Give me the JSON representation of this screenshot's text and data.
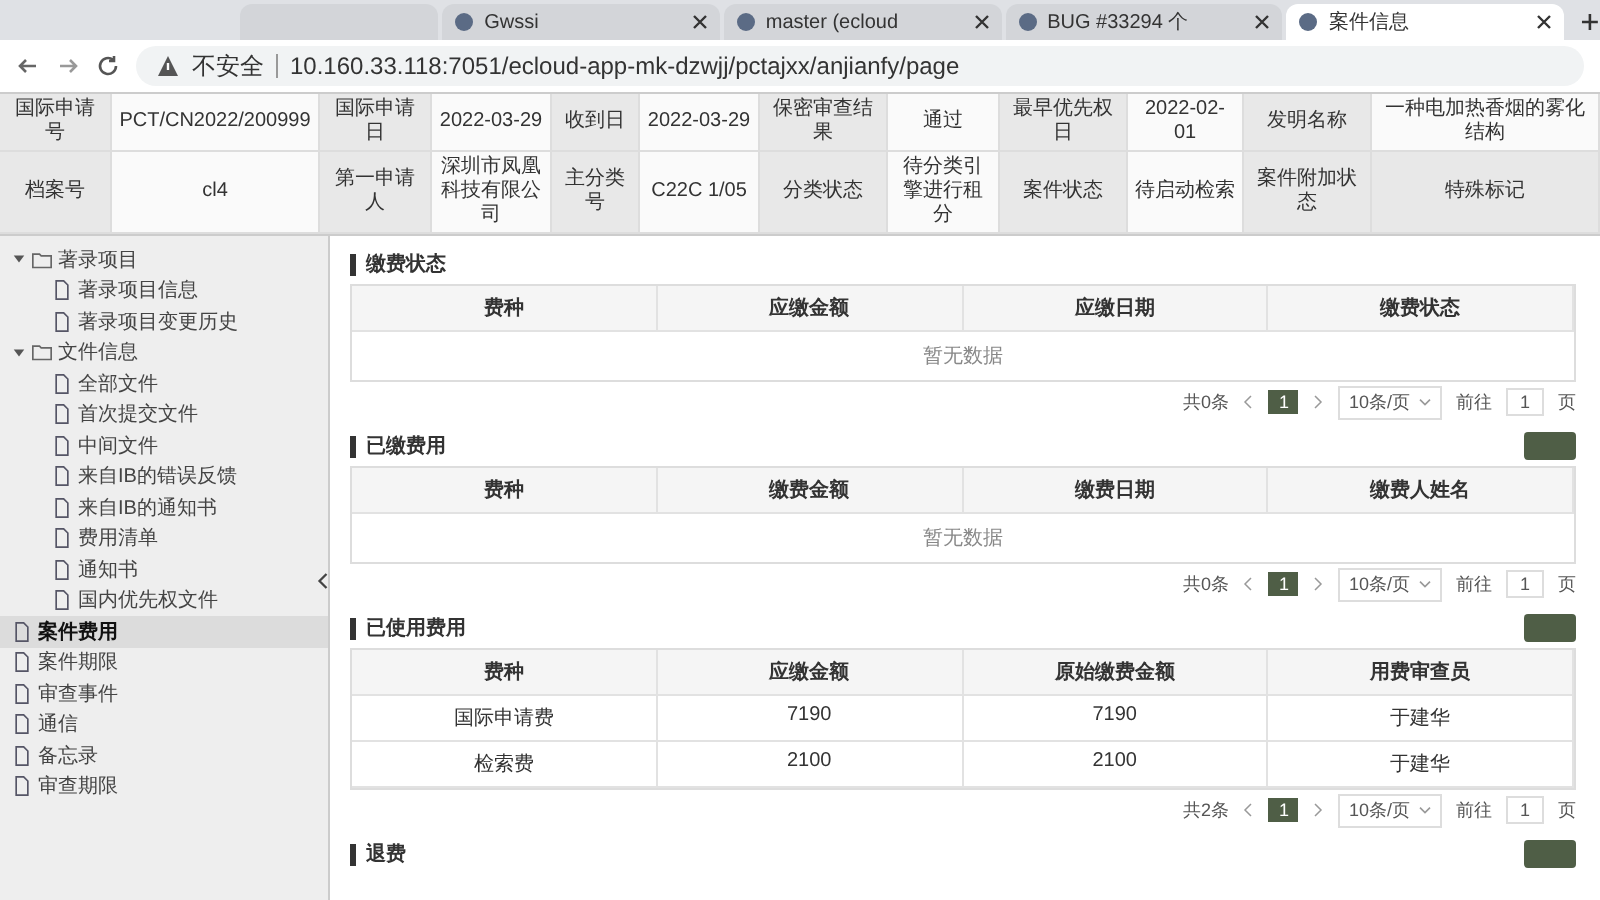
{
  "browser": {
    "tabs": [
      {
        "title": "Gwssi",
        "selected": false
      },
      {
        "title": "master (ecloud",
        "selected": false
      },
      {
        "title": "BUG #33294 个",
        "selected": false
      },
      {
        "title": "案件信息",
        "selected": true
      }
    ],
    "address": {
      "security": "不安全",
      "url": "10.160.33.118:7051/ecloud-app-mk-dzwjj/pctajxx/anjianfy/page"
    }
  },
  "header": {
    "rows": [
      [
        {
          "kind": "label",
          "text": "国际申请号"
        },
        {
          "kind": "value",
          "text": "PCT/CN2022/200999"
        },
        {
          "kind": "label",
          "text": "国际申请日"
        },
        {
          "kind": "value",
          "text": "2022-03-29"
        },
        {
          "kind": "label",
          "text": "收到日"
        },
        {
          "kind": "value",
          "text": "2022-03-29"
        },
        {
          "kind": "label",
          "text": "保密审查结果"
        },
        {
          "kind": "value",
          "text": "通过"
        },
        {
          "kind": "label",
          "text": "最早优先权日"
        },
        {
          "kind": "value",
          "text": "2022-02-01"
        },
        {
          "kind": "label",
          "text": "发明名称"
        },
        {
          "kind": "value",
          "text": "一种电加热香烟的雾化结构"
        }
      ],
      [
        {
          "kind": "label",
          "text": "档案号"
        },
        {
          "kind": "value",
          "text": "cl4"
        },
        {
          "kind": "label",
          "text": "第一申请人"
        },
        {
          "kind": "value",
          "text": "深圳市凤凰科技有限公司"
        },
        {
          "kind": "label",
          "text": "主分类号"
        },
        {
          "kind": "value",
          "text": "C22C 1/05"
        },
        {
          "kind": "label",
          "text": "分类状态"
        },
        {
          "kind": "value",
          "text": "待分类引擎进行租分"
        },
        {
          "kind": "label",
          "text": "案件状态"
        },
        {
          "kind": "value",
          "text": "待启动检索"
        },
        {
          "kind": "label",
          "text": "案件附加状态"
        },
        {
          "kind": "label",
          "text": "特殊标记"
        }
      ]
    ]
  },
  "sidebar": {
    "items": [
      {
        "label": "著录项目",
        "expanded": true,
        "selected": false,
        "children": [
          {
            "label": "著录项目信息",
            "selected": false
          },
          {
            "label": "著录项目变更历史",
            "selected": false
          }
        ]
      },
      {
        "label": "文件信息",
        "expanded": true,
        "selected": false,
        "children": [
          {
            "label": "全部文件",
            "selected": false
          },
          {
            "label": "首次提交文件",
            "selected": false
          },
          {
            "label": "中间文件",
            "selected": false
          },
          {
            "label": "来自IB的错误反馈",
            "selected": false
          },
          {
            "label": "来自IB的通知书",
            "selected": false
          },
          {
            "label": "费用清单",
            "selected": false
          },
          {
            "label": "通知书",
            "selected": false
          },
          {
            "label": "国内优先权文件",
            "selected": false
          }
        ]
      },
      {
        "label": "案件费用",
        "selected": true
      },
      {
        "label": "案件期限",
        "selected": false
      },
      {
        "label": "审查事件",
        "selected": false
      },
      {
        "label": "通信",
        "selected": false
      },
      {
        "label": "备忘录",
        "selected": false
      },
      {
        "label": "审查期限",
        "selected": false
      }
    ]
  },
  "sections": [
    {
      "title": "缴费状态",
      "has_button": false,
      "columns": [
        "费种",
        "应缴金额",
        "应缴日期",
        "缴费状态"
      ],
      "empty_text": "暂无数据",
      "pager": {
        "total": "共0条",
        "page": "1",
        "page_size": "10条/页",
        "goto_label": "前往",
        "goto_value": "1",
        "goto_suffix": "页"
      }
    },
    {
      "title": "已缴费用",
      "has_button": true,
      "columns": [
        "费种",
        "缴费金额",
        "缴费日期",
        "缴费人姓名"
      ],
      "empty_text": "暂无数据",
      "pager": {
        "total": "共0条",
        "page": "1",
        "page_size": "10条/页",
        "goto_label": "前往",
        "goto_value": "1",
        "goto_suffix": "页"
      }
    },
    {
      "title": "已使用费用",
      "has_button": true,
      "columns": [
        "费种",
        "应缴金额",
        "原始缴费金额",
        "用费审查员"
      ],
      "rows": [
        [
          "国际申请费",
          "7190",
          "7190",
          "于建华"
        ],
        [
          "检索费",
          "2100",
          "2100",
          "于建华"
        ]
      ],
      "pager": {
        "total": "共2条",
        "page": "1",
        "page_size": "10条/页",
        "goto_label": "前往",
        "goto_value": "1",
        "goto_suffix": "页"
      }
    },
    {
      "title": "退费",
      "has_button": true
    }
  ]
}
